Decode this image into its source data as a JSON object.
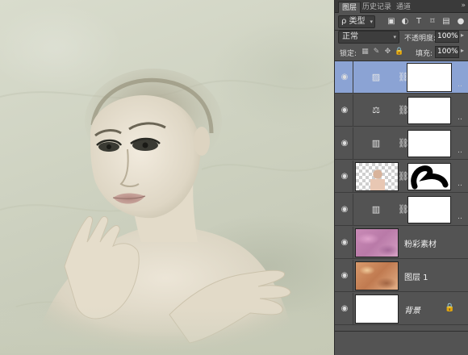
{
  "panel": {
    "tabs": [
      "图层",
      "历史记录",
      "通道"
    ],
    "menu_glyph": "»",
    "filter": {
      "label": "ρ 类型",
      "icons": [
        "image-filter-icon",
        "adjustment-filter-icon",
        "type-filter-icon",
        "shape-filter-icon",
        "smart-object-filter-icon"
      ]
    },
    "blend_mode": "正常",
    "opacity_label": "不透明度:",
    "opacity_value": "100%",
    "lock_label": "锁定:",
    "fill_label": "填充:",
    "fill_value": "100%"
  },
  "layers": [
    {
      "name": "",
      "type": "adjustment",
      "icon": "gradient-map-icon",
      "selected": true
    },
    {
      "name": "",
      "type": "adjustment",
      "icon": "color-balance-icon",
      "selected": false
    },
    {
      "name": "",
      "type": "adjustment",
      "icon": "levels-icon",
      "selected": false
    },
    {
      "name": "",
      "type": "pixel-with-mask",
      "thumb": "portrait",
      "selected": false
    },
    {
      "name": "",
      "type": "adjustment",
      "icon": "levels-icon",
      "selected": false
    },
    {
      "name": "粉彩素材",
      "type": "pixel",
      "thumb": "pink-texture",
      "selected": false
    },
    {
      "name": "图层 1",
      "type": "pixel",
      "thumb": "orange-texture",
      "selected": false
    },
    {
      "name": "背景",
      "type": "background",
      "thumb": "white",
      "locked": true,
      "selected": false
    }
  ],
  "colors": {
    "selected_layer": "#8ba3d4",
    "panel_bg": "#535353",
    "canvas_bg": "#cfd3c2"
  }
}
